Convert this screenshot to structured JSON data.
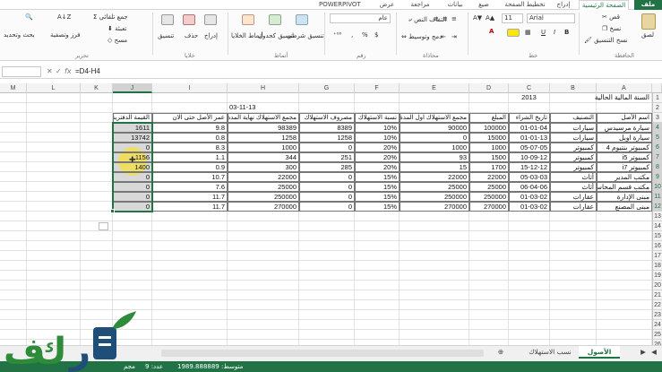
{
  "tabs": [
    "ملف",
    "الصفحة الرئيسية",
    "إدراج",
    "تخطيط الصفحة",
    "صيغ",
    "بيانات",
    "مراجعة",
    "عرض",
    "POWERPIVOT"
  ],
  "ribbon": {
    "clipboard": {
      "paste": "لصق",
      "cut": "قص",
      "copy": "نسخ",
      "format_painter": "نسخ التنسيق",
      "group": "الحافظة"
    },
    "font": {
      "name": "Arial",
      "size": "11",
      "group": "خط"
    },
    "alignment": {
      "wrap": "التفاف النص",
      "merge": "دمج وتوسيط",
      "group": "محاذاة"
    },
    "number": {
      "format": "عام",
      "group": "رقم"
    },
    "styles": {
      "conditional": "تنسيق شرطي",
      "as_table": "تنسيق كجدول",
      "cell_styles": "أنماط الخلايا",
      "group": "أنماط"
    },
    "cells": {
      "insert": "إدراج",
      "delete": "حذف",
      "format": "تنسيق",
      "group": "خلايا"
    },
    "editing": {
      "autosum": "جمع تلقائي",
      "fill": "تعبئة",
      "clear": "مسح",
      "sort": "فرز وتصفية",
      "find": "بحث وتحديد",
      "group": "تحرير"
    }
  },
  "formula_bar": {
    "formula": "=D4-H4"
  },
  "columns": [
    "M",
    "L",
    "K",
    "J",
    "I",
    "H",
    "G",
    "F",
    "E",
    "D",
    "C",
    "B",
    "A"
  ],
  "rows": [
    "1",
    "2",
    "3",
    "4",
    "5",
    "6",
    "7",
    "8",
    "9",
    "10",
    "11",
    "12",
    "13",
    "14",
    "15",
    "16",
    "17",
    "18",
    "19",
    "20",
    "21",
    "22",
    "23",
    "24",
    "25",
    "26"
  ],
  "sheet": {
    "A1": "السنة المالية الحالية",
    "C1": "2013",
    "H2": "03-11-13",
    "headers": {
      "A": "اسم الأصل",
      "B": "التصنيف",
      "C": "تاريخ الشراء",
      "D": "المبلغ",
      "E": "مجمع الاستهلاك اول المدة",
      "F": "نسبة الاستهلاك",
      "G": "مصروف الاستهلاك",
      "H": "مجمع الاستهلاك نهاية المدة",
      "I": "عمر الأصل حتى الان",
      "J": "القيمة الدفترية"
    },
    "data": [
      {
        "A": "سيارة مرسيدس",
        "B": "سيارات",
        "C": "01-01-04",
        "D": "100000",
        "E": "90000",
        "F": "10%",
        "G": "8389",
        "H": "98389",
        "I": "9.8",
        "J": "1611"
      },
      {
        "A": "سيارة اوبل",
        "B": "سيارات",
        "C": "01-01-13",
        "D": "15000",
        "E": "0",
        "F": "10%",
        "G": "1258",
        "H": "1258",
        "I": "0.8",
        "J": "13742"
      },
      {
        "A": "كمبيوتر بنتيوم 4",
        "B": "كمبيوتر",
        "C": "05-07-05",
        "D": "1000",
        "E": "1000",
        "F": "20%",
        "G": "0",
        "H": "1000",
        "I": "8.3",
        "J": "0"
      },
      {
        "A": "كمبيوتر i5",
        "B": "كمبيوتر",
        "C": "10-09-12",
        "D": "1500",
        "E": "93",
        "F": "20%",
        "G": "251",
        "H": "344",
        "I": "1.1",
        "J": "1156"
      },
      {
        "A": "كمبيوتر i7",
        "B": "كمبيوتر",
        "C": "15-12-12",
        "D": "1700",
        "E": "15",
        "F": "20%",
        "G": "285",
        "H": "300",
        "I": "0.9",
        "J": "1400"
      },
      {
        "A": "مكتب المدير",
        "B": "أثاث",
        "C": "05-03-03",
        "D": "22000",
        "E": "22000",
        "F": "15%",
        "G": "0",
        "H": "22000",
        "I": "10.7",
        "J": "0"
      },
      {
        "A": "مكتب قسم المحاسبة",
        "B": "أثاث",
        "C": "06-04-06",
        "D": "25000",
        "E": "25000",
        "F": "15%",
        "G": "0",
        "H": "25000",
        "I": "7.6",
        "J": "0"
      },
      {
        "A": "مبنى الإدارة",
        "B": "عقارات",
        "C": "01-03-02",
        "D": "250000",
        "E": "250000",
        "F": "15%",
        "G": "0",
        "H": "250000",
        "I": "11.7",
        "J": "0"
      },
      {
        "A": "مبنى المصنع",
        "B": "عقارات",
        "C": "01-03-02",
        "D": "270000",
        "E": "270000",
        "F": "15%",
        "G": "0",
        "H": "270000",
        "I": "11.7",
        "J": "0"
      }
    ]
  },
  "sheet_tabs": [
    "الأصول",
    "نسب الاستهلاك"
  ],
  "status": {
    "average": "متوسط: 1989.888889",
    "count": "عدد: 9",
    "sum": "مجم"
  },
  "logo_text": "فكرة",
  "colors": {
    "excel_green": "#217346",
    "highlight": "#f6e03c",
    "logo_green": "#2e8b3a",
    "logo_blue": "#1f4e79"
  }
}
